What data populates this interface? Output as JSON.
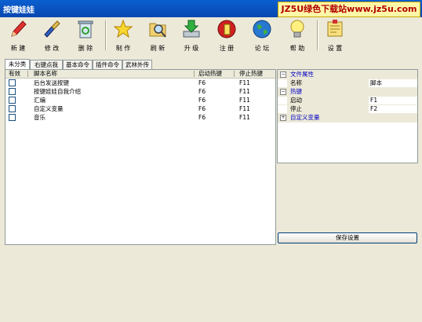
{
  "window": {
    "title": "按键娃娃"
  },
  "watermark": {
    "text": "JZ5U绿色下载站www.jz5u.com"
  },
  "toolbar": {
    "buttons": [
      {
        "label": "新 建",
        "icon": "pencil-icon"
      },
      {
        "label": "修 改",
        "icon": "brush-icon"
      },
      {
        "label": "删 除",
        "icon": "recycle-bin-icon"
      },
      {
        "label": "制 作",
        "icon": "star-icon"
      },
      {
        "label": "刷 新",
        "icon": "folder-search-icon"
      },
      {
        "label": "升 级",
        "icon": "download-icon"
      },
      {
        "label": "注 册",
        "icon": "register-icon"
      },
      {
        "label": "论 坛",
        "icon": "globe-icon"
      },
      {
        "label": "帮 助",
        "icon": "lightbulb-icon"
      },
      {
        "label": "设 置",
        "icon": "settings-note-icon"
      }
    ]
  },
  "tabs": [
    "未分类",
    "右键点我",
    "基本命令",
    "插件命令",
    "武林外传"
  ],
  "list": {
    "columns": [
      "有效",
      "脚本名称",
      "启动热键",
      "停止热键"
    ],
    "rows": [
      {
        "name": "后台发送按键",
        "start": "F6",
        "stop": "F11"
      },
      {
        "name": "按键娃娃自我介绍",
        "start": "F6",
        "stop": "F11"
      },
      {
        "name": "汇编",
        "start": "F6",
        "stop": "F11"
      },
      {
        "name": "自定义变量",
        "start": "F6",
        "stop": "F11"
      },
      {
        "name": "音乐",
        "start": "F6",
        "stop": "F11"
      }
    ]
  },
  "properties": {
    "file_attr": "文件属性",
    "name_key": "名称",
    "name_val": "脚本",
    "hotkey": "热键",
    "start_key": "启动",
    "start_val": "F1",
    "stop_key": "停止",
    "stop_val": "F2",
    "custom_var": "自定义变量"
  },
  "save_button": "保存设置",
  "colors": {
    "titlebar": "#0a5fd0",
    "window_bg": "#ece9d8",
    "category_text": "#0000c0"
  }
}
